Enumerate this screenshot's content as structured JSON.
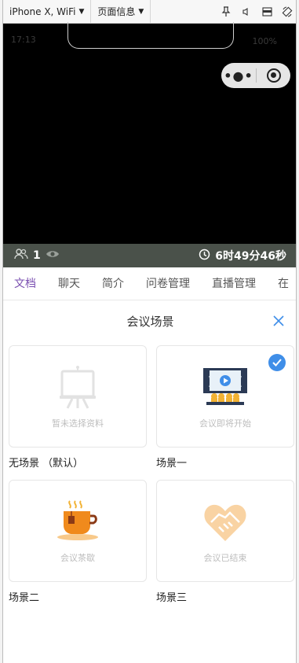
{
  "devtools": {
    "device_selector": "iPhone X, WiFi",
    "page_info": "页面信息"
  },
  "video": {
    "time": "17:13",
    "battery": "100%"
  },
  "stats": {
    "viewers": "1",
    "duration": "6时49分46秒"
  },
  "tabs": [
    "文档",
    "聊天",
    "简介",
    "问卷管理",
    "直播管理",
    "在"
  ],
  "panel": {
    "title": "会议场景",
    "cards": [
      {
        "caption": "暂未选择资料",
        "label": "无场景 （默认）",
        "selected": false
      },
      {
        "caption": "会议即将开始",
        "label": "场景一",
        "selected": true
      },
      {
        "caption": "会议茶歇",
        "label": "场景二",
        "selected": false
      },
      {
        "caption": "会议已结束",
        "label": "场景三",
        "selected": false
      }
    ]
  },
  "colors": {
    "accent": "#7a4fb0",
    "check": "#3f8ee8",
    "strip": "#4a514a"
  }
}
